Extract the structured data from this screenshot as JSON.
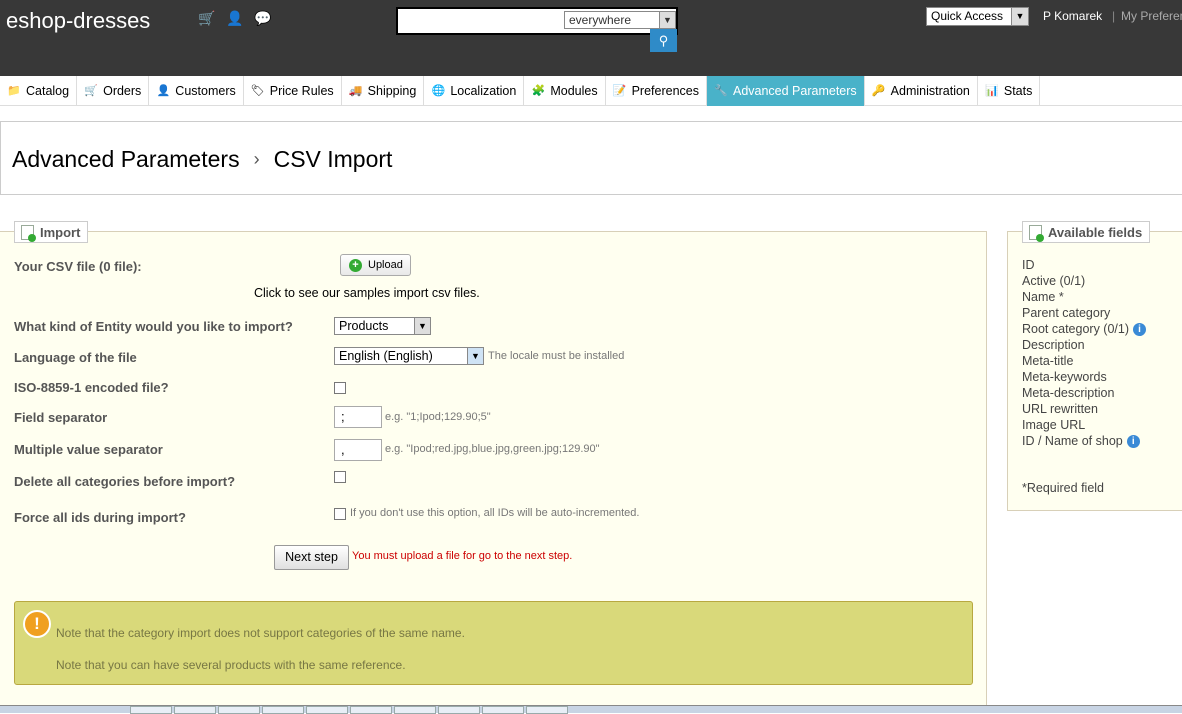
{
  "header": {
    "brand": "eshop-dresses",
    "search_scope": "everywhere",
    "quick_access": "Quick Access",
    "user": "P Komarek",
    "separator": "|",
    "my_preferences": "My Preferences"
  },
  "nav": {
    "tabs": [
      {
        "label": "Catalog",
        "icon": "folder-icon"
      },
      {
        "label": "Orders",
        "icon": "cart-icon"
      },
      {
        "label": "Customers",
        "icon": "user-icon"
      },
      {
        "label": "Price Rules",
        "icon": "price-tag-icon"
      },
      {
        "label": "Shipping",
        "icon": "truck-icon"
      },
      {
        "label": "Localization",
        "icon": "globe-icon"
      },
      {
        "label": "Modules",
        "icon": "puzzle-icon"
      },
      {
        "label": "Preferences",
        "icon": "preferences-icon"
      },
      {
        "label": "Advanced Parameters",
        "icon": "wrench-icon"
      },
      {
        "label": "Administration",
        "icon": "key-icon"
      },
      {
        "label": "Stats",
        "icon": "chart-icon"
      }
    ]
  },
  "breadcrumb": {
    "section": "Advanced Parameters",
    "sep": "›",
    "page": "CSV Import"
  },
  "import": {
    "legend": "Import",
    "csv_label": "Your CSV file (0 file):",
    "upload_label": "Upload",
    "samples_link": "Click to see our samples import csv files.",
    "entity_label": "What kind of Entity would you like to import?",
    "entity_value": "Products",
    "language_label": "Language of the file",
    "language_value": "English (English)",
    "language_hint": "The locale must be installed",
    "iso_label": "ISO-8859-1 encoded file?",
    "field_sep_label": "Field separator",
    "field_sep_value": ";",
    "field_sep_hint": "e.g. \"1;Ipod;129.90;5\"",
    "multi_sep_label": "Multiple value separator",
    "multi_sep_value": ",",
    "multi_sep_hint": "e.g. \"Ipod;red.jpg,blue.jpg,green.jpg;129.90\"",
    "delete_label": "Delete all categories before import?",
    "force_label": "Force all ids during import?",
    "force_hint": "If you don't use this option, all IDs will be auto-incremented.",
    "next_label": "Next step",
    "error_text": "You must upload a file for go to the next step.",
    "warning_1": "Note that the category import does not support categories of the same name.",
    "warning_2": "Note that you can have several products with the same reference."
  },
  "available_fields": {
    "legend": "Available fields",
    "items": [
      {
        "label": "ID",
        "info": false
      },
      {
        "label": "Active (0/1)",
        "info": false
      },
      {
        "label": "Name *",
        "info": false
      },
      {
        "label": "Parent category",
        "info": false
      },
      {
        "label": "Root category (0/1)",
        "info": true
      },
      {
        "label": "Description",
        "info": false
      },
      {
        "label": "Meta-title",
        "info": false
      },
      {
        "label": "Meta-keywords",
        "info": false
      },
      {
        "label": "Meta-description",
        "info": false
      },
      {
        "label": "URL rewritten",
        "info": false
      },
      {
        "label": "Image URL",
        "info": false
      },
      {
        "label": "ID / Name of shop",
        "info": true
      }
    ],
    "required_note": "*Required field"
  }
}
